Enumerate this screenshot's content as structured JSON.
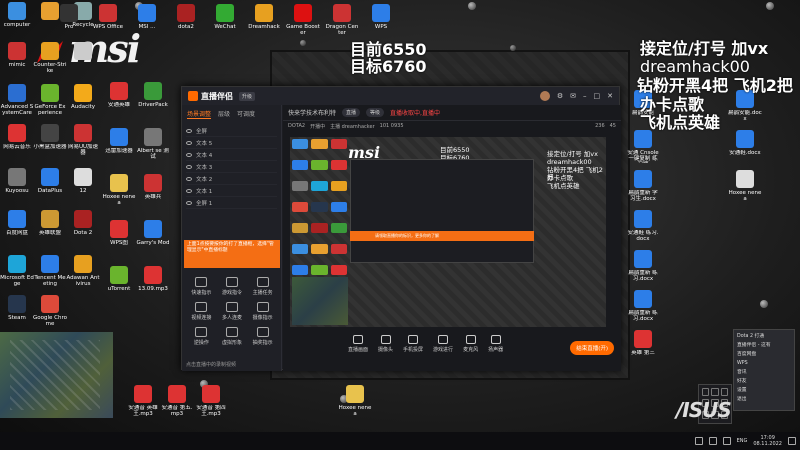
{
  "overlay": {
    "current": "目前6550",
    "target": "目标6760",
    "promo_lines": [
      "接定位/打号 加vx",
      "dreamhack00",
      "钻粉开黑4把 飞机2把",
      "办卡点歌",
      "飞机点英雄"
    ]
  },
  "desktop_icons_left": [
    {
      "label": "computer",
      "color": "#3b8fe0"
    },
    {
      "label": "",
      "color": "#e8a030"
    },
    {
      "label": "Recycle",
      "color": "#8aa"
    },
    {
      "label": "mimic",
      "color": "#c33"
    },
    {
      "label": "Counter-Strike",
      "color": "#e7a020"
    },
    {
      "label": "",
      "color": "#ccc"
    },
    {
      "label": "Advanced SystemCare",
      "color": "#2b6ed1"
    },
    {
      "label": "GeForce Experience",
      "color": "#6ab42d"
    },
    {
      "label": "Audacity",
      "color": "#f3aa1a"
    },
    {
      "label": "网易云音乐",
      "color": "#d33"
    },
    {
      "label": "小黑盒加速器",
      "color": "#444"
    },
    {
      "label": "网易UU加速器",
      "color": "#c33"
    },
    {
      "label": "Kuyoosu",
      "color": "#777"
    },
    {
      "label": "DataPlus",
      "color": "#2d7ee8"
    },
    {
      "label": "12",
      "color": "#ddd"
    },
    {
      "label": "百度网盘",
      "color": "#2d7ee8"
    },
    {
      "label": "英雄联盟",
      "color": "#c93"
    },
    {
      "label": "Dota 2",
      "color": "#a22"
    },
    {
      "label": "Microsoft Edge",
      "color": "#1ea5d8"
    },
    {
      "label": "Tencent Meeting",
      "color": "#2d7ee8"
    },
    {
      "label": "Adawan Antivirus",
      "color": "#e7a020"
    },
    {
      "label": "Steam",
      "color": "#26364d"
    },
    {
      "label": "Google Chrome",
      "color": "#dd4a3a"
    }
  ],
  "desktop_labels_top": [
    "Pro",
    "WPS Office",
    "MSI ...",
    "dota2",
    "WeChat",
    "Dreamhack",
    "Game Booster",
    "Dragon Center",
    "WPS"
  ],
  "desktop_icons_mid": [
    {
      "label": "安通英雄",
      "color": "#d33"
    },
    {
      "label": "DriverPack",
      "color": "#3a9a3a"
    },
    {
      "label": "迅雷加速器",
      "color": "#2d7ee8"
    },
    {
      "label": "Albert se 测试",
      "color": "#777"
    },
    {
      "label": "Hoxee nenea",
      "color": "#e8c24d"
    },
    {
      "label": "英雄兵",
      "color": "#c33"
    },
    {
      "label": "WPS图",
      "color": "#d33"
    },
    {
      "label": "Garry's Mod",
      "color": "#2d7ee8"
    },
    {
      "label": "uTorrent",
      "color": "#6ab42d"
    },
    {
      "label": "13.09.mp3",
      "color": "#d33"
    }
  ],
  "desktop_icons_right": [
    {
      "label": "扁鹊安能",
      "color": "#2d7ee8"
    },
    {
      "label": "安通 Cnsole 一键复制 练习题",
      "color": "#2d7ee8"
    },
    {
      "label": "扁鹊重新 学习生.docx",
      "color": "#2d7ee8"
    },
    {
      "label": "安通鞋 练习.docx",
      "color": "#2d7ee8"
    },
    {
      "label": "扁鹊重新 练习.docx",
      "color": "#2d7ee8"
    },
    {
      "label": "扁鹊重新 练习.docx",
      "color": "#2d7ee8"
    },
    {
      "label": "英雄 第三",
      "color": "#d33"
    }
  ],
  "desktop_icons_far_right": [
    {
      "label": "扁鹊安能.docx",
      "color": "#2d7ee8"
    },
    {
      "label": "安通鞋.docx",
      "color": "#2d7ee8"
    },
    {
      "label": "Hoxee nenea",
      "color": "#ddd"
    }
  ],
  "desktop_icons_bottom": [
    {
      "label": "安通音 英雄王.mp3",
      "color": "#d33"
    },
    {
      "label": "安通音 第五.mp3",
      "color": "#d33"
    },
    {
      "label": "安通音 第四王.mp3",
      "color": "#d33"
    },
    {
      "label": "Hoxee nenea",
      "color": "#e8c24d"
    }
  ],
  "app": {
    "title": "直播伴侣",
    "version_tag": "升级",
    "left_tabs": [
      "场景调整",
      "层级",
      "可调度"
    ],
    "layers": [
      "全屏",
      "文本 5",
      "文本 4",
      "文本 3",
      "文本 2",
      "文本 1",
      "全屏 1"
    ],
    "warning": "上面1点按要按你的打了直播框，选择\"管理显示\"中直播标题",
    "tools": [
      "快速指示",
      "游戏指令",
      "主播任务",
      "视频连接",
      "多人连麦",
      "摄像指示",
      "逆操作",
      "虚拟形象",
      "抽奖指示"
    ],
    "bottom_tip": "点击直播中的录制视频",
    "info": {
      "title": "快来学技术布利特",
      "pill1": "直播",
      "pill2": "等级",
      "warning": "直播收取中,直播中",
      "status": [
        "DOTA2",
        "开播中",
        "主播 dreamhacker",
        "101 0935"
      ],
      "counts": [
        "236",
        "45"
      ]
    },
    "preview_strip": "请领取直播你的标识，更多你的了解",
    "controls": [
      "直播画面",
      "摄像头",
      "手机投屏",
      "游戏进行",
      "麦克风",
      "扬声器"
    ],
    "go_live": "结束直播(开)"
  },
  "popup_menu": [
    "Dota 2 打通",
    "直播伴侣 - 这有",
    "百度网盘",
    "WPS",
    "音讯",
    "好友",
    "设置",
    "退出"
  ],
  "taskbar": {
    "lang": "ENG",
    "time": "17:09",
    "date": "08.11.2022"
  }
}
